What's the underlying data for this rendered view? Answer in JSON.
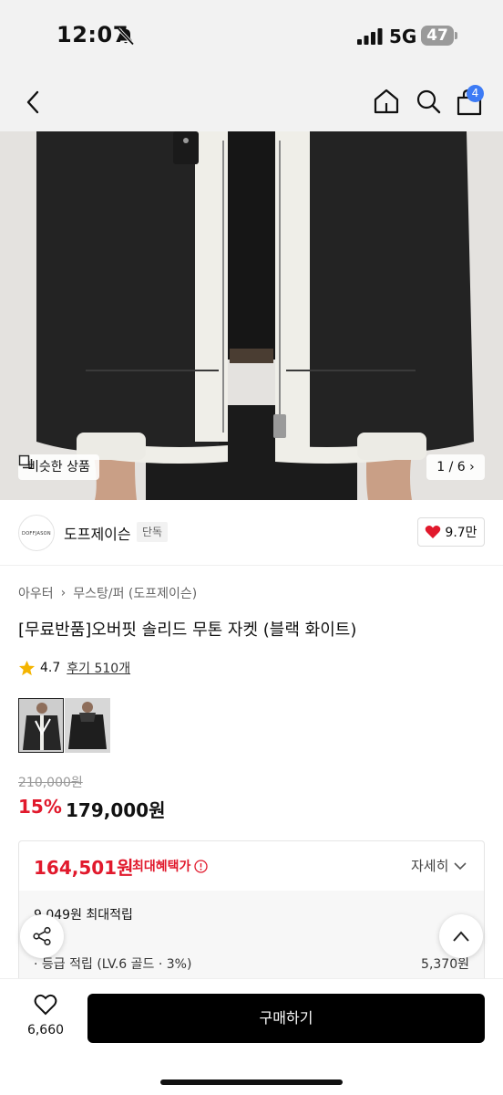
{
  "status_bar": {
    "time": "12:07",
    "network": "5G",
    "battery": "47"
  },
  "nav": {
    "cart_count": "4"
  },
  "hero": {
    "similar_label": "비슷한 상품",
    "image_counter": "1 / 6"
  },
  "brand": {
    "logo_text": "DOFFJASON",
    "name": "도프제이슨",
    "badge": "단독",
    "likes": "9.7만"
  },
  "breadcrumb": {
    "items": [
      "아우터",
      "무스탕/퍼 (도프제이슨)"
    ]
  },
  "product": {
    "title": "[무료반품]오버핏 솔리드 무톤 자켓 (블랙 화이트)",
    "rating": "4.7",
    "review_text": "후기 510개",
    "original_price": "210,000원",
    "discount_rate": "15%",
    "sale_price": "179,000원"
  },
  "benefit": {
    "max_price": "164,501원",
    "max_label": "최대혜택가",
    "detail_label": "자세히",
    "points_total": "9,049원 최대적립",
    "grade_label": "· 등급 적립 (LV.6 골드 · 3%)",
    "grade_value": "5,370원"
  },
  "bottom_bar": {
    "wish_count": "6,660",
    "buy_label": "구매하기"
  },
  "colors": {
    "accent_red": "#e1192c",
    "badge_blue": "#3d7bf5",
    "buy_black": "#000000"
  }
}
